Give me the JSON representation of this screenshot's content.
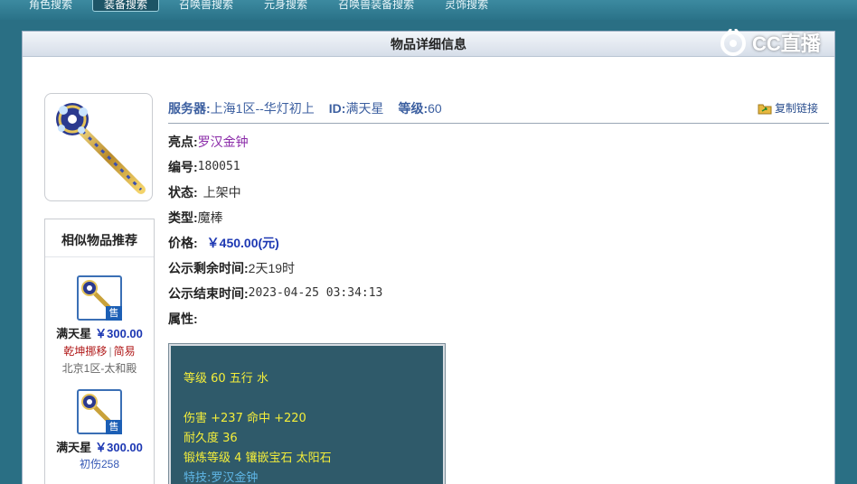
{
  "nav": {
    "tabs": [
      "角色搜索",
      "装备搜索",
      "召唤兽搜索",
      "元身搜索",
      "召唤兽装备搜索",
      "灵饰搜索"
    ],
    "active_index": 1
  },
  "panel": {
    "title": "物品详细信息"
  },
  "watermark": {
    "text": "CC直播"
  },
  "item": {
    "server_label": "服务器:",
    "server_value": "上海1区--华灯初上",
    "id_label": "ID:",
    "id_value": "满天星",
    "level_label": "等级:",
    "level_value": "60",
    "copy_link": "复制链接",
    "highlight_label": "亮点:",
    "highlight_value": "罗汉金钟",
    "number_label": "编号:",
    "number_value": "180051",
    "status_label": "状态:",
    "status_value": "上架中",
    "type_label": "类型:",
    "type_value": "魔棒",
    "price_label": "价格:",
    "price_value": "￥450.00(元)",
    "remaining_label": "公示剩余时间:",
    "remaining_value": "2天19时",
    "end_label": "公示结束时间:",
    "end_value": "2023-04-25 03:34:13",
    "attr_label": "属性:"
  },
  "attributes": {
    "line1": "等级 60  五行 水",
    "line2": "伤害 +237 命中 +220",
    "line3": "耐久度 36",
    "line4": "锻炼等级 4  镶嵌宝石 太阳石",
    "line5": "特技:罗汉金钟"
  },
  "similar": {
    "title": "相似物品推荐",
    "sale_badge": "售",
    "items": [
      {
        "name": "满天星",
        "price": "￥300.00",
        "tag1": "乾坤挪移",
        "tag2": "简易",
        "server": "北京1区-太和殿"
      },
      {
        "name": "满天星",
        "price": "￥300.00",
        "tag1": "初伤258"
      }
    ]
  },
  "colors": {
    "nav_bg": "#2a7288",
    "attr_bg": "#2f5a6a",
    "attr_text": "#f4ee3a",
    "price_blue": "#1d38b3",
    "highlight_purple": "#8a2aa8"
  }
}
